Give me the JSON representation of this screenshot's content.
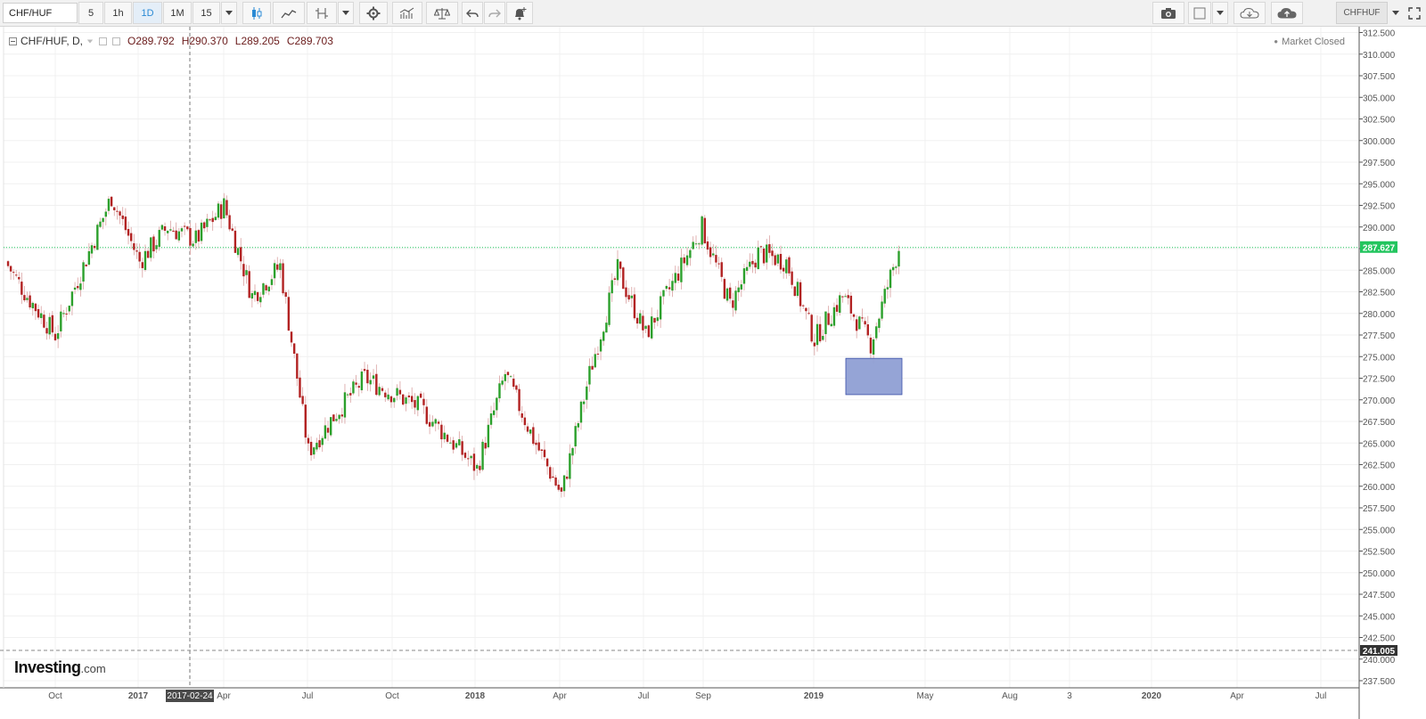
{
  "toolbar": {
    "symbol_value": "CHF/HUF",
    "intervals": [
      "5",
      "1h",
      "1D",
      "1M",
      "15"
    ],
    "active_interval": "1D",
    "ticker": "CHFHUF"
  },
  "legend": {
    "title": "CHF/HUF, D,",
    "open": "O289.792",
    "high": "H290.370",
    "low": "L289.205",
    "close": "C289.703"
  },
  "market_status": "Market Closed",
  "branding": {
    "logo": "Investing",
    "logo_suffix": ".com"
  },
  "colors": {
    "up": "#2ca02c",
    "down": "#b22222",
    "price_line": "#22c55e",
    "box": "#8f9fd4"
  },
  "chart_data": {
    "type": "candlestick",
    "y_axis": {
      "range": [
        236.5,
        313.5
      ],
      "ticks": [
        "237.500",
        "240.000",
        "242.500",
        "245.000",
        "247.500",
        "250.000",
        "252.500",
        "255.000",
        "257.500",
        "260.000",
        "262.500",
        "265.000",
        "267.500",
        "270.000",
        "272.500",
        "275.000",
        "277.500",
        "280.000",
        "282.500",
        "285.000",
        "287.500",
        "290.000",
        "292.500",
        "295.000",
        "297.500",
        "300.000",
        "302.500",
        "305.000",
        "307.500",
        "310.000",
        "312.500"
      ]
    },
    "x_axis": {
      "labels": [
        "Oct",
        "2017",
        "Apr",
        "Jul",
        "Oct",
        "2018",
        "Apr",
        "Jul",
        "Sep",
        "2019",
        "May",
        "Aug",
        "3",
        "2020",
        "Apr",
        "Jul"
      ],
      "crosshair_date": "2017-02-24"
    },
    "current_price": "287.627",
    "reference_level": "241.005",
    "price_path": [
      {
        "x": "Aug 2016",
        "y": 286.0
      },
      {
        "x": "Sep 2016",
        "y": 282.0
      },
      {
        "x": "Oct 2016",
        "y": 277.5
      },
      {
        "x": "Nov 2016",
        "y": 285.5
      },
      {
        "x": "Dec 2016",
        "y": 293.5
      },
      {
        "x": "Jan 2017",
        "y": 286.0
      },
      {
        "x": "Feb 2017",
        "y": 290.0
      },
      {
        "x": "Mar 2017",
        "y": 288.5
      },
      {
        "x": "Apr 2017",
        "y": 292.5
      },
      {
        "x": "May 2017",
        "y": 282.0
      },
      {
        "x": "Jun 2017",
        "y": 285.5
      },
      {
        "x": "Jul 2017",
        "y": 264.0
      },
      {
        "x": "Aug 2017",
        "y": 268.5
      },
      {
        "x": "Sep 2017",
        "y": 272.5
      },
      {
        "x": "Nov 2017",
        "y": 269.0
      },
      {
        "x": "Jan 2018",
        "y": 262.0
      },
      {
        "x": "Feb 2018",
        "y": 273.0
      },
      {
        "x": "Mar 2018",
        "y": 265.5
      },
      {
        "x": "Apr 2018",
        "y": 259.0
      },
      {
        "x": "May 2018",
        "y": 273.0
      },
      {
        "x": "Jun 2018",
        "y": 285.0
      },
      {
        "x": "Jul 2018",
        "y": 277.5
      },
      {
        "x": "Sep 2018",
        "y": 290.0
      },
      {
        "x": "Oct 2018",
        "y": 281.0
      },
      {
        "x": "Nov 2018",
        "y": 287.0
      },
      {
        "x": "Dec 2018",
        "y": 286.0
      },
      {
        "x": "Jan 2019",
        "y": 277.0
      },
      {
        "x": "Feb 2019",
        "y": 282.0
      },
      {
        "x": "Mar 2019",
        "y": 276.5
      },
      {
        "x": "Apr 2019",
        "y": 287.6
      }
    ]
  }
}
